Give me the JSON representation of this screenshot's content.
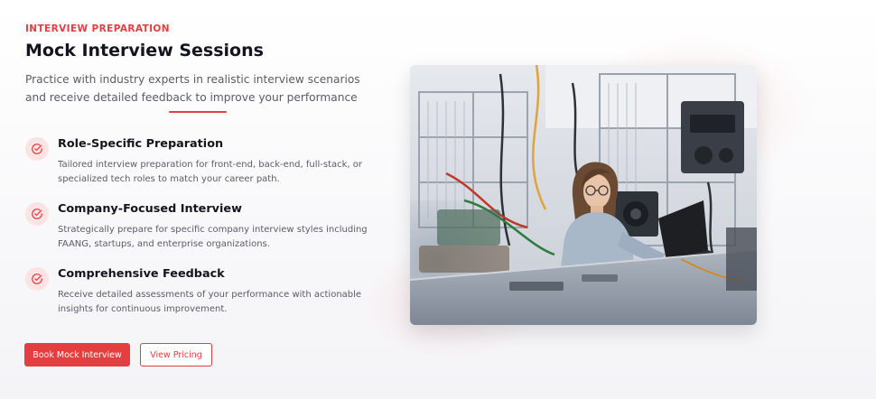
{
  "section": {
    "eyebrow": "INTERVIEW PREPARATION",
    "title": "Mock Interview Sessions",
    "subtitle": "Practice with industry experts in realistic interview scenarios and receive detailed feedback to improve your performance"
  },
  "features": [
    {
      "icon": "check-circle-icon",
      "title": "Role-Specific Preparation",
      "description": "Tailored interview preparation for front-end, back-end, full-stack, or specialized tech roles to match your career path."
    },
    {
      "icon": "check-circle-icon",
      "title": "Company-Focused Interview",
      "description": "Strategically prepare for specific company interview styles including FAANG, startups, and enterprise organizations."
    },
    {
      "icon": "check-circle-icon",
      "title": "Comprehensive Feedback",
      "description": "Receive detailed assessments of your performance with actionable insights for continuous improvement."
    }
  ],
  "actions": {
    "primary_label": "Book Mock Interview",
    "secondary_label": "View Pricing"
  },
  "image": {
    "subject": "woman-working-on-laptop-in-electronics-lab"
  },
  "colors": {
    "accent": "#e53e3e",
    "icon_bg": "#fde4e4",
    "heading": "#14141f",
    "body_text": "#5b5b66"
  }
}
